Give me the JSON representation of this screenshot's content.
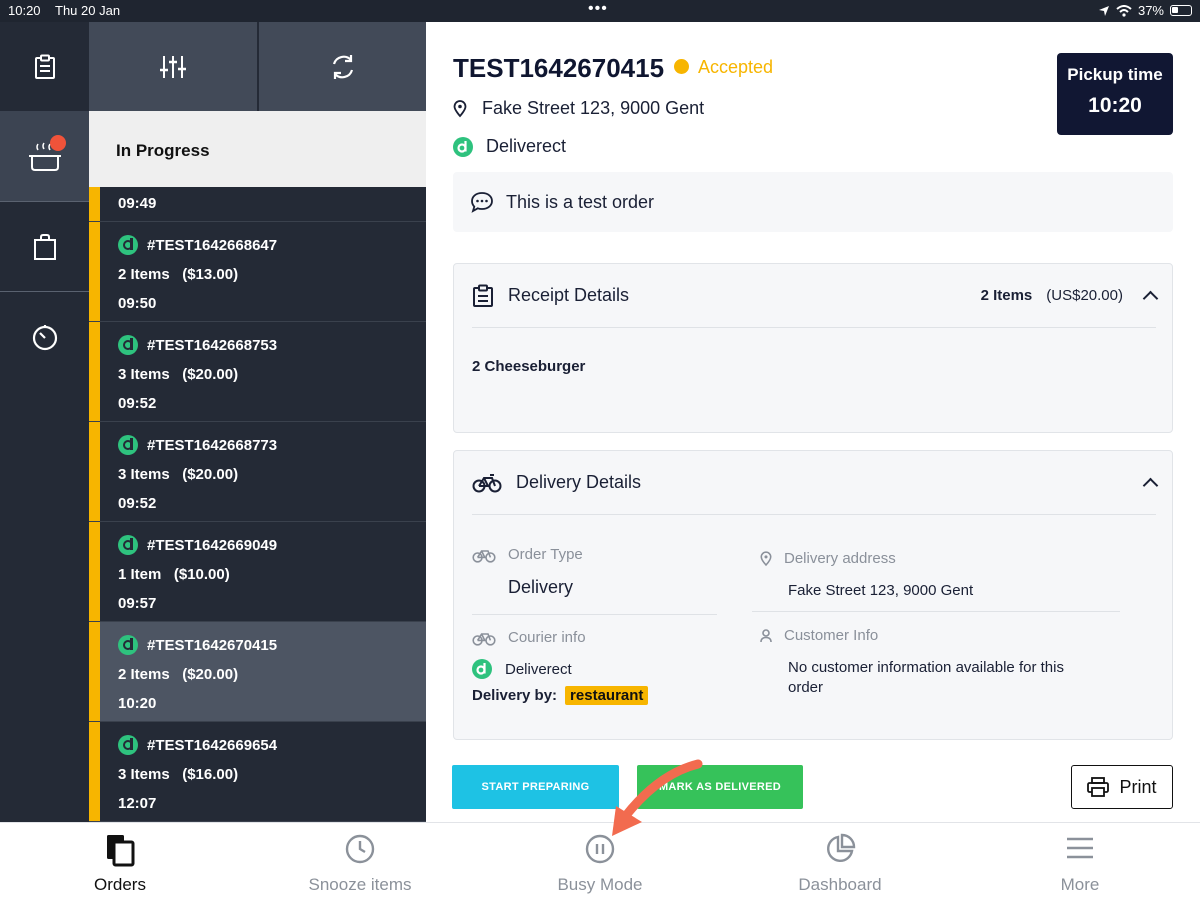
{
  "status_bar": {
    "time": "10:20",
    "date": "Thu 20 Jan",
    "battery": "37%"
  },
  "list": {
    "section_title": "In Progress",
    "partial_time": "09:49",
    "orders": [
      {
        "id": "#TEST1642668647",
        "items": "2 Items   ($13.00)",
        "time": "09:50"
      },
      {
        "id": "#TEST1642668753",
        "items": "3 Items   ($20.00)",
        "time": "09:52"
      },
      {
        "id": "#TEST1642668773",
        "items": "3 Items   ($20.00)",
        "time": "09:52"
      },
      {
        "id": "#TEST1642669049",
        "items": "1 Item   ($10.00)",
        "time": "09:57"
      },
      {
        "id": "#TEST1642670415",
        "items": "2 Items   ($20.00)",
        "time": "10:20"
      },
      {
        "id": "#TEST1642669654",
        "items": "3 Items   ($16.00)",
        "time": "12:07"
      }
    ],
    "selected_index": 4
  },
  "detail": {
    "order_id": "TEST1642670415",
    "status": "Accepted",
    "address": "Fake Street 123, 9000 Gent",
    "source": "Deliverect",
    "pickup_label": "Pickup time",
    "pickup_time": "10:20",
    "note": "This is a test order",
    "receipt": {
      "title": "Receipt Details",
      "count": "2 Items",
      "total": "(US$20.00)",
      "lines": [
        "2 Cheeseburger"
      ]
    },
    "delivery": {
      "title": "Delivery Details",
      "order_type_label": "Order Type",
      "order_type": "Delivery",
      "address_label": "Delivery address",
      "address": "Fake Street 123, 9000 Gent",
      "courier_label": "Courier info",
      "courier": "Deliverect",
      "delivery_by_label": "Delivery by:",
      "delivery_by": "restaurant",
      "customer_label": "Customer Info",
      "customer": "No customer information available for this order"
    }
  },
  "actions": {
    "start": "START PREPARING",
    "deliver": "MARK AS DELIVERED",
    "print": "Print"
  },
  "tabs": [
    {
      "label": "Orders",
      "icon": "orders-icon"
    },
    {
      "label": "Snooze items",
      "icon": "clock-icon"
    },
    {
      "label": "Busy Mode",
      "icon": "pause-icon"
    },
    {
      "label": "Dashboard",
      "icon": "pie-chart-icon"
    },
    {
      "label": "More",
      "icon": "menu-icon"
    }
  ],
  "colors": {
    "accent_yellow": "#f7b500",
    "brand_dark": "#111733",
    "start_button": "#1ec2e4",
    "deliver_button": "#36c25a",
    "annotation_arrow": "#f26b4f"
  }
}
